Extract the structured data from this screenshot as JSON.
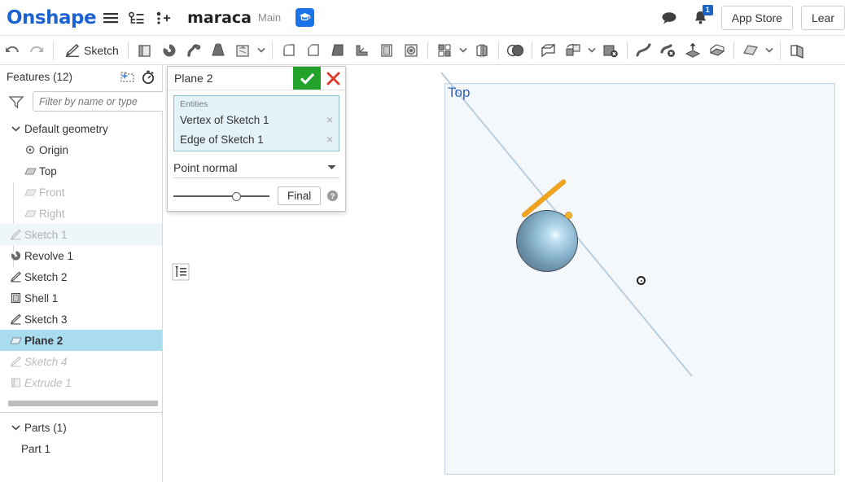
{
  "topbar": {
    "logo": "Onshape",
    "document_title": "maraca",
    "branch": "Main",
    "icons": {
      "menu": "hamburger-menu-icon",
      "versions": "version-graph-icon",
      "insert": "add-node-icon",
      "learn_badge": "graduation-cap-icon",
      "comment": "comment-bubble-icon",
      "bell": "notification-bell-icon"
    },
    "notification_count": "1",
    "app_store_label": "App Store",
    "learn_label": "Lear"
  },
  "toolbar": {
    "undo": "undo-arrow-icon",
    "redo": "redo-arrow-icon",
    "sketch_label": "Sketch",
    "items": [
      {
        "name": "extrude-icon"
      },
      {
        "name": "revolve-icon"
      },
      {
        "name": "sweep-icon"
      },
      {
        "name": "loft-icon"
      },
      {
        "name": "thicken-icon"
      },
      {
        "name": "fillet-icon"
      },
      {
        "name": "chamfer-icon"
      },
      {
        "name": "draft-icon"
      },
      {
        "name": "rib-icon"
      },
      {
        "name": "shell-icon"
      },
      {
        "name": "hole-icon"
      },
      {
        "name": "linear-pattern-icon"
      },
      {
        "name": "mirror-icon"
      },
      {
        "name": "boolean-icon"
      },
      {
        "name": "split-icon"
      },
      {
        "name": "transform-icon"
      },
      {
        "name": "delete-part-icon"
      },
      {
        "name": "curves-icon"
      },
      {
        "name": "delete-face-icon"
      },
      {
        "name": "move-face-icon"
      },
      {
        "name": "enclose-icon"
      },
      {
        "name": "plane-icon"
      },
      {
        "name": "sheet-metal-icon"
      }
    ]
  },
  "sidebar": {
    "features_title": "Features (12)",
    "new_folder_icon": "new-folder-icon",
    "history_icon": "stopwatch-icon",
    "filter_placeholder": "Filter by name or type",
    "filter_value": "",
    "filter_icon": "funnel-filter-icon",
    "default_geometry": {
      "label": "Default geometry",
      "children": [
        {
          "label": "Origin",
          "icon": "origin-icon",
          "state": "normal"
        },
        {
          "label": "Top",
          "icon": "plane-icon",
          "state": "normal"
        },
        {
          "label": "Front",
          "icon": "plane-icon",
          "state": "dim"
        },
        {
          "label": "Right",
          "icon": "plane-icon",
          "state": "dim"
        }
      ]
    },
    "features": [
      {
        "label": "Sketch 1",
        "icon": "sketch-icon",
        "state": "faint"
      },
      {
        "label": "Revolve 1",
        "icon": "revolve-icon",
        "state": "normal"
      },
      {
        "label": "Sketch 2",
        "icon": "sketch-icon",
        "state": "normal"
      },
      {
        "label": "Shell 1",
        "icon": "shell-icon",
        "state": "normal"
      },
      {
        "label": "Sketch 3",
        "icon": "sketch-icon",
        "state": "normal"
      },
      {
        "label": "Plane 2",
        "icon": "plane-icon",
        "state": "selected"
      },
      {
        "label": "Sketch 4",
        "icon": "sketch-icon",
        "state": "rolledback"
      },
      {
        "label": "Extrude 1",
        "icon": "extrude-icon",
        "state": "rolledback"
      }
    ],
    "parts": {
      "label": "Parts (1)",
      "items": [
        {
          "label": "Part 1"
        }
      ]
    }
  },
  "dialog": {
    "title": "Plane 2",
    "accept_icon": "checkmark-icon",
    "cancel_icon": "close-x-icon",
    "entities_label": "Entities",
    "entities": [
      {
        "label": "Vertex of Sketch 1"
      },
      {
        "label": "Edge of Sketch 1"
      }
    ],
    "remove_glyph": "×",
    "plane_type": "Point normal",
    "slider_value": 55,
    "final_label": "Final",
    "help_icon": "help-question-icon"
  },
  "viewport": {
    "plane_label": "Top",
    "feature_list_icon": "feature-list-icon",
    "origin_marker": "origin-point-icon",
    "colors": {
      "plane_fill": "#f4f8fb",
      "plane_border": "#c3d5e6",
      "plane_label": "#2f62bb",
      "highlight_orange": "#f0a41e",
      "selection_blue": "#aadcf0",
      "brand_blue": "#1d62d1"
    }
  }
}
